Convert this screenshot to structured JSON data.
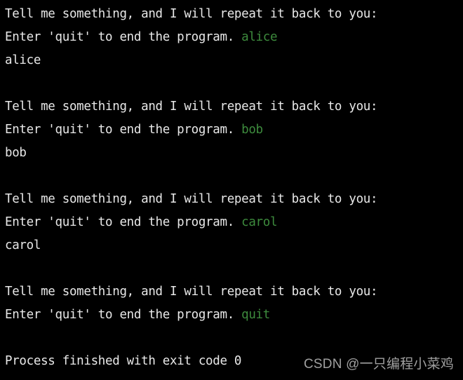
{
  "app": {
    "kind": "python-console-output",
    "background_color": "#000000",
    "default_text_color": "#e8e8e8",
    "input_echo_color": "#3d8b3d"
  },
  "console": {
    "lines": [
      {
        "type": "prompt",
        "prompt": "Tell me something, and I will repeat it back to you:",
        "input": ""
      },
      {
        "type": "prompt-input",
        "prompt": "Enter 'quit' to end the program. ",
        "input": "alice"
      },
      {
        "type": "echo",
        "text": "alice"
      },
      {
        "type": "blank",
        "text": ""
      },
      {
        "type": "prompt",
        "prompt": "Tell me something, and I will repeat it back to you:",
        "input": ""
      },
      {
        "type": "prompt-input",
        "prompt": "Enter 'quit' to end the program. ",
        "input": "bob"
      },
      {
        "type": "echo",
        "text": "bob"
      },
      {
        "type": "blank",
        "text": ""
      },
      {
        "type": "prompt",
        "prompt": "Tell me something, and I will repeat it back to you:",
        "input": ""
      },
      {
        "type": "prompt-input",
        "prompt": "Enter 'quit' to end the program. ",
        "input": "carol"
      },
      {
        "type": "echo",
        "text": "carol"
      },
      {
        "type": "blank",
        "text": ""
      },
      {
        "type": "prompt",
        "prompt": "Tell me something, and I will repeat it back to you:",
        "input": ""
      },
      {
        "type": "prompt-input",
        "prompt": "Enter 'quit' to end the program. ",
        "input": "quit"
      },
      {
        "type": "blank",
        "text": ""
      },
      {
        "type": "status",
        "text": "Process finished with exit code 0"
      }
    ]
  },
  "watermark": {
    "text": "CSDN @一只编程小菜鸡"
  }
}
